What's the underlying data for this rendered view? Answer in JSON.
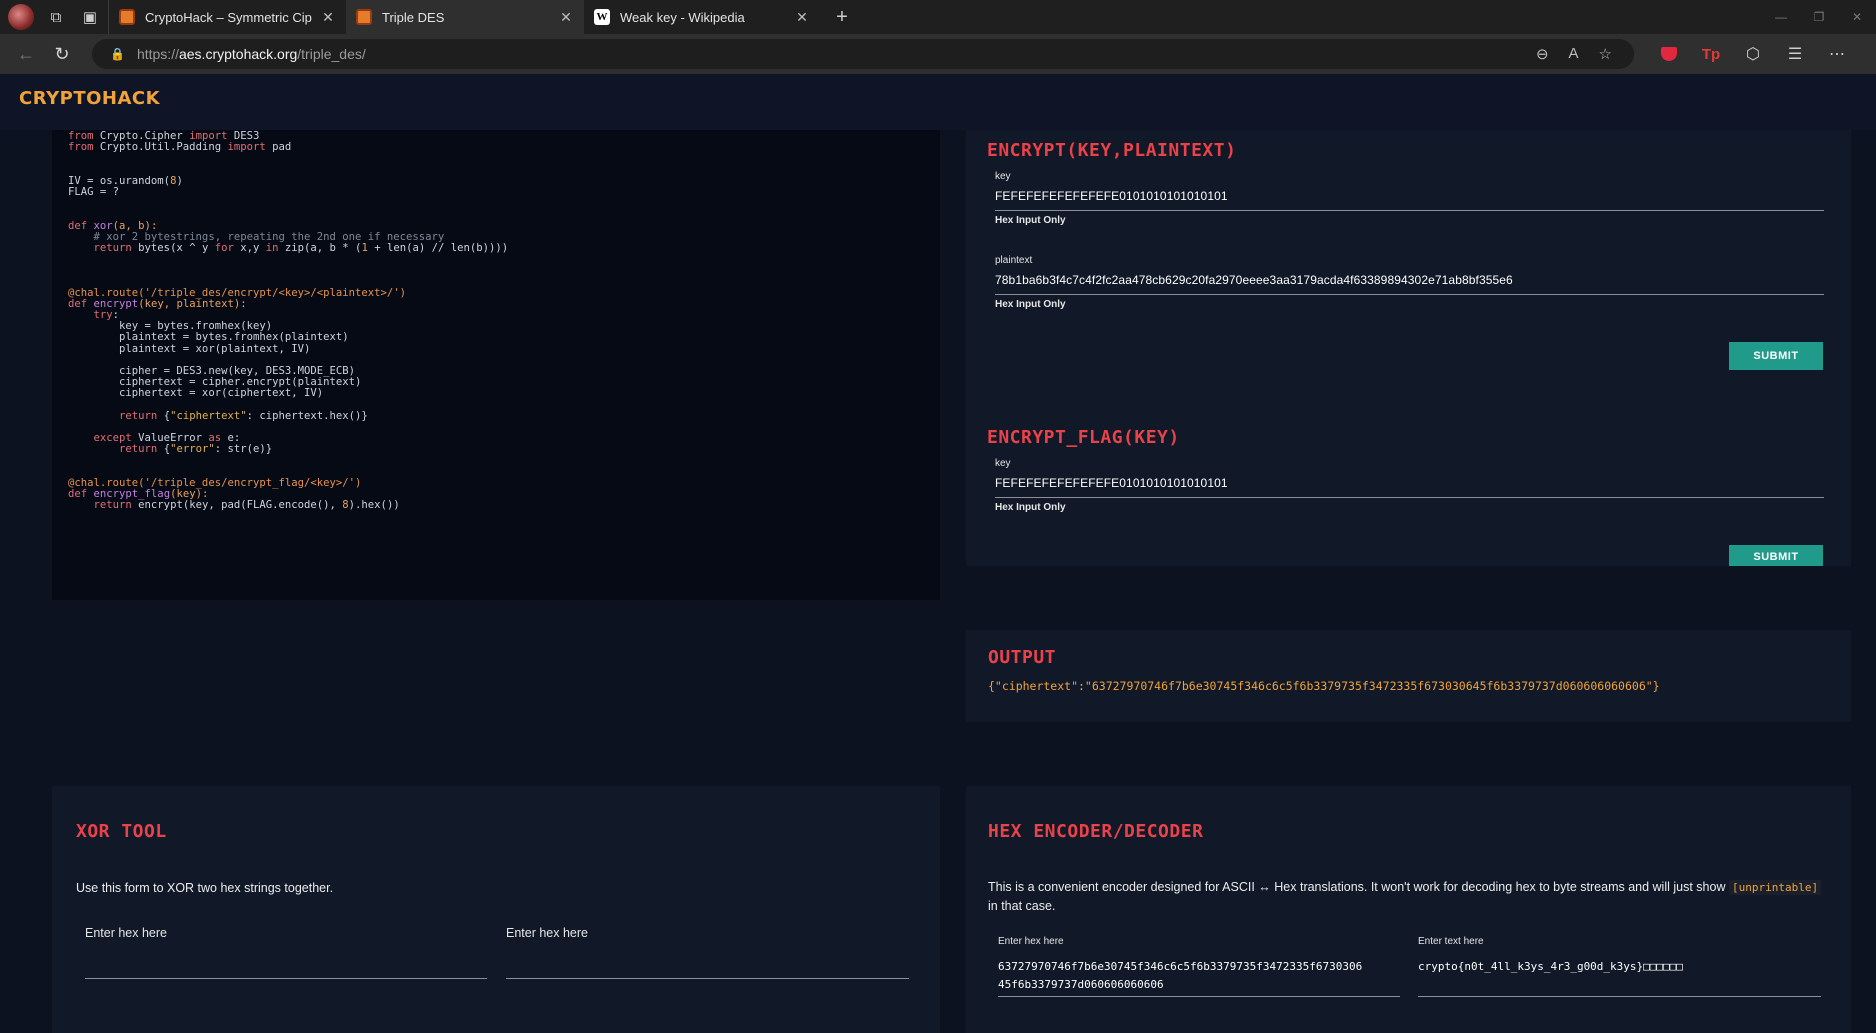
{
  "browser": {
    "tabs": [
      {
        "title": "CryptoHack – Symmetric Ciphers",
        "favicon": "cryptohack-favicon"
      },
      {
        "title": "Triple DES",
        "favicon": "cryptohack-favicon"
      },
      {
        "title": "Weak key - Wikipedia",
        "favicon": "wikipedia-favicon",
        "favicon_letter": "W"
      }
    ],
    "url": {
      "protocol": "https://",
      "host": "aes.cryptohack.org",
      "path": "/triple_des/"
    }
  },
  "site": {
    "logo": "CRYPTOHACK"
  },
  "code": {
    "lines": [
      [
        {
          "t": "from",
          "c": "kw"
        },
        {
          "t": " Crypto.Cipher "
        },
        {
          "t": "import",
          "c": "kw"
        },
        {
          "t": " DES3"
        }
      ],
      [
        {
          "t": "from",
          "c": "kw"
        },
        {
          "t": " Crypto.Util.Padding "
        },
        {
          "t": "import",
          "c": "kw"
        },
        {
          "t": " pad"
        }
      ],
      [],
      [],
      [
        {
          "t": "IV = os.urandom("
        },
        {
          "t": "8",
          "c": "num"
        },
        {
          "t": ")"
        }
      ],
      [
        {
          "t": "FLAG = ?"
        }
      ],
      [],
      [],
      [
        {
          "t": "def",
          "c": "kw"
        },
        {
          "t": " "
        },
        {
          "t": "xor",
          "c": "fn"
        },
        {
          "t": "(a, b):",
          "c": "num"
        }
      ],
      [
        {
          "t": "    # xor 2 bytestrings, repeating the 2nd one if necessary",
          "c": "cm"
        }
      ],
      [
        {
          "t": "    "
        },
        {
          "t": "return",
          "c": "kw"
        },
        {
          "t": " bytes(x ^ y "
        },
        {
          "t": "for",
          "c": "kw"
        },
        {
          "t": " x,y "
        },
        {
          "t": "in",
          "c": "kw"
        },
        {
          "t": " zip(a, b * ("
        },
        {
          "t": "1",
          "c": "num"
        },
        {
          "t": " + len(a) // len(b))))"
        }
      ],
      [],
      [],
      [],
      [
        {
          "t": "@chal.route('/triple_des/encrypt/<key>/<plaintext>/')",
          "c": "dec"
        }
      ],
      [
        {
          "t": "def",
          "c": "kw"
        },
        {
          "t": " "
        },
        {
          "t": "encrypt",
          "c": "fn"
        },
        {
          "t": "(key, plaintext):",
          "c": "num"
        }
      ],
      [
        {
          "t": "    "
        },
        {
          "t": "try",
          "c": "kw"
        },
        {
          "t": ":"
        }
      ],
      [
        {
          "t": "        key = bytes.fromhex(key)"
        }
      ],
      [
        {
          "t": "        plaintext = bytes.fromhex(plaintext)"
        }
      ],
      [
        {
          "t": "        plaintext = xor(plaintext, IV)"
        }
      ],
      [],
      [
        {
          "t": "        cipher = DES3.new(key, DES3.MODE_ECB)"
        }
      ],
      [
        {
          "t": "        ciphertext = cipher.encrypt(plaintext)"
        }
      ],
      [
        {
          "t": "        ciphertext = xor(ciphertext, IV)"
        }
      ],
      [],
      [
        {
          "t": "        "
        },
        {
          "t": "return",
          "c": "kw"
        },
        {
          "t": " {"
        },
        {
          "t": "\"ciphertext\"",
          "c": "str"
        },
        {
          "t": ": ciphertext.hex()}"
        }
      ],
      [],
      [
        {
          "t": "    "
        },
        {
          "t": "except",
          "c": "kw"
        },
        {
          "t": " ValueError "
        },
        {
          "t": "as",
          "c": "kw"
        },
        {
          "t": " e:"
        }
      ],
      [
        {
          "t": "        "
        },
        {
          "t": "return",
          "c": "kw"
        },
        {
          "t": " {"
        },
        {
          "t": "\"error\"",
          "c": "str"
        },
        {
          "t": ": str(e)}"
        }
      ],
      [],
      [],
      [
        {
          "t": "@chal.route('/triple_des/encrypt_flag/<key>/')",
          "c": "dec"
        }
      ],
      [
        {
          "t": "def",
          "c": "kw"
        },
        {
          "t": " "
        },
        {
          "t": "encrypt_flag",
          "c": "fn"
        },
        {
          "t": "(key):",
          "c": "num"
        }
      ],
      [
        {
          "t": "    "
        },
        {
          "t": "return",
          "c": "kw"
        },
        {
          "t": " encrypt(key, pad(FLAG.encode(), "
        },
        {
          "t": "8",
          "c": "num"
        },
        {
          "t": ").hex())"
        }
      ]
    ]
  },
  "encrypt": {
    "title": "ENCRYPT(KEY,PLAINTEXT)",
    "key_label": "key",
    "key_value": "FEFEFEFEFEFEFEFE0101010101010101",
    "key_hint": "Hex Input Only",
    "plaintext_label": "plaintext",
    "plaintext_value": "78b1ba6b3f4c7c4f2fc2aa478cb629c20fa2970eeee3aa3179acda4f63389894302e71ab8bf355e6",
    "plaintext_hint": "Hex Input Only",
    "submit": "SUBMIT"
  },
  "encrypt_flag": {
    "title": "ENCRYPT_FLAG(KEY)",
    "key_label": "key",
    "key_value": "FEFEFEFEFEFEFEFE0101010101010101",
    "key_hint": "Hex Input Only",
    "submit": "SUBMIT"
  },
  "output": {
    "title": "OUTPUT",
    "text": "{\"ciphertext\":\"63727970746f7b6e30745f346c6c5f6b3379735f3472335f673030645f6b3379737d060606060606\"}"
  },
  "xor_tool": {
    "title": "XOR TOOL",
    "description": "Use this form to XOR two hex strings together.",
    "input1_label": "Enter hex here",
    "input2_label": "Enter hex here"
  },
  "hex_tool": {
    "title": "HEX ENCODER/DECODER",
    "description_before": "This is a convenient encoder designed for ASCII ↔ Hex translations. It won't work for decoding hex to byte streams and will just show",
    "description_code": "[unprintable]",
    "description_after": "in that case.",
    "hex_label": "Enter hex here",
    "hex_value_line1": "63727970746f7b6e30745f346c6c5f6b3379735f3472335f6730306",
    "hex_value_line2": "45f6b3379737d060606060606",
    "text_label": "Enter text here",
    "text_value": "crypto{n0t_4ll_k3ys_4r3_g00d_k3ys}□□□□□□"
  }
}
